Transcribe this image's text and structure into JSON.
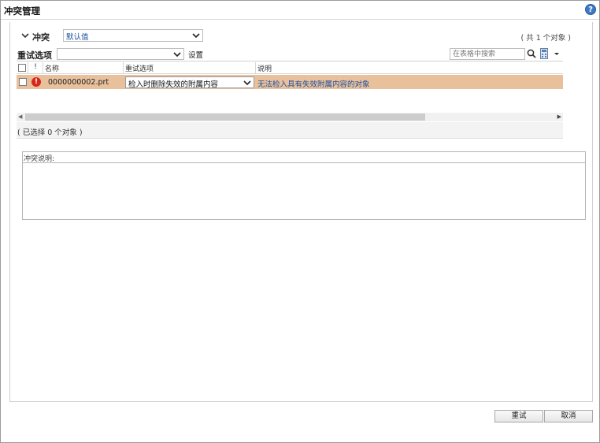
{
  "window": {
    "title": "冲突管理",
    "help_icon": "help-icon"
  },
  "conflicts": {
    "section_label": "冲突",
    "preset_value": "默认值",
    "total_count": "( 共 1 个对象 )"
  },
  "toolbar": {
    "retry_label": "重试选项",
    "retry_value": "",
    "settings_label": "设置",
    "search_placeholder": "在表格中搜索"
  },
  "table": {
    "columns": [
      "!",
      "名称",
      "重试选项",
      "说明"
    ],
    "rows": [
      {
        "name": "0000000002.prt",
        "retry_option": "检入时删除失效的附属内容",
        "description": "无法检入具有失效附属内容的对象",
        "status": "error"
      }
    ],
    "selected_count": "( 已选择 0 个对象 )"
  },
  "description_panel": {
    "title": "冲突说明:"
  },
  "buttons": {
    "retry": "重试",
    "cancel": "取消"
  },
  "colors": {
    "row_highlight": "#e8c09c",
    "link_blue": "#1d4f9e",
    "error_red": "#d8261c"
  }
}
